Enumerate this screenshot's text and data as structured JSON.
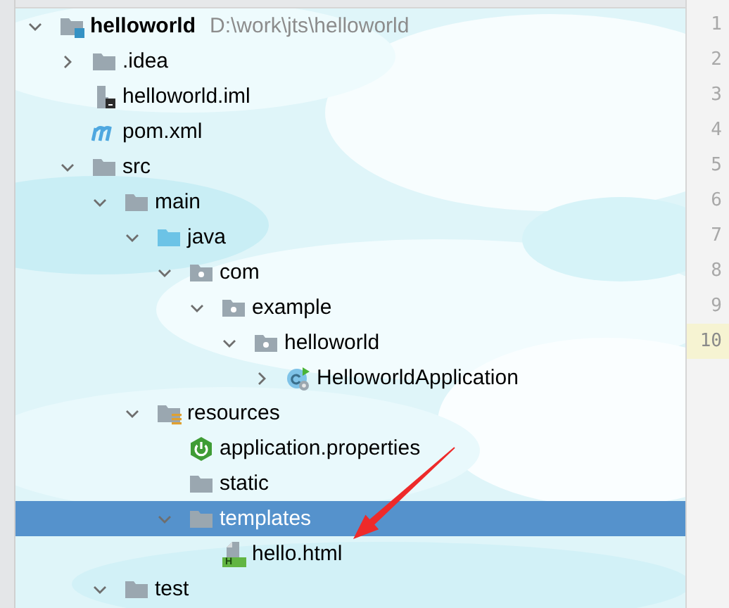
{
  "project_tree": [
    {
      "label": "helloworld",
      "path": "D:\\work\\jts\\helloworld",
      "kind": "module",
      "expanded": true,
      "selected": false,
      "children": [
        {
          "label": ".idea",
          "kind": "folder",
          "expanded": false,
          "selected": false
        },
        {
          "label": "helloworld.iml",
          "kind": "iml",
          "selected": false
        },
        {
          "label": "pom.xml",
          "kind": "maven",
          "selected": false
        },
        {
          "label": "src",
          "kind": "folder",
          "expanded": true,
          "selected": false,
          "children": [
            {
              "label": "main",
              "kind": "folder",
              "expanded": true,
              "selected": false,
              "children": [
                {
                  "label": "java",
                  "kind": "source",
                  "expanded": true,
                  "selected": false,
                  "children": [
                    {
                      "label": "com",
                      "kind": "package",
                      "expanded": true,
                      "selected": false,
                      "children": [
                        {
                          "label": "example",
                          "kind": "package",
                          "expanded": true,
                          "selected": false,
                          "children": [
                            {
                              "label": "helloworld",
                              "kind": "package",
                              "expanded": true,
                              "selected": false,
                              "children": [
                                {
                                  "label": "HelloworldApplication",
                                  "kind": "class",
                                  "expanded": false,
                                  "selected": false
                                }
                              ]
                            }
                          ]
                        }
                      ]
                    }
                  ]
                },
                {
                  "label": "resources",
                  "kind": "resources",
                  "expanded": true,
                  "selected": false,
                  "children": [
                    {
                      "label": "application.properties",
                      "kind": "properties",
                      "selected": false
                    },
                    {
                      "label": "static",
                      "kind": "folder",
                      "selected": false
                    },
                    {
                      "label": "templates",
                      "kind": "folder",
                      "expanded": true,
                      "selected": true,
                      "children": [
                        {
                          "label": "hello.html",
                          "kind": "html",
                          "badge": "H",
                          "selected": false
                        }
                      ]
                    }
                  ]
                }
              ]
            },
            {
              "label": "test",
              "kind": "folder",
              "expanded": true,
              "selected": false
            }
          ]
        }
      ]
    }
  ],
  "line_numbers": [
    {
      "label": "1",
      "current": false
    },
    {
      "label": "2",
      "current": false
    },
    {
      "label": "3",
      "current": false
    },
    {
      "label": "4",
      "current": false
    },
    {
      "label": "5",
      "current": false
    },
    {
      "label": "6",
      "current": false
    },
    {
      "label": "7",
      "current": false
    },
    {
      "label": "8",
      "current": false
    },
    {
      "label": "9",
      "current": false
    },
    {
      "label": "10",
      "current": true
    }
  ]
}
